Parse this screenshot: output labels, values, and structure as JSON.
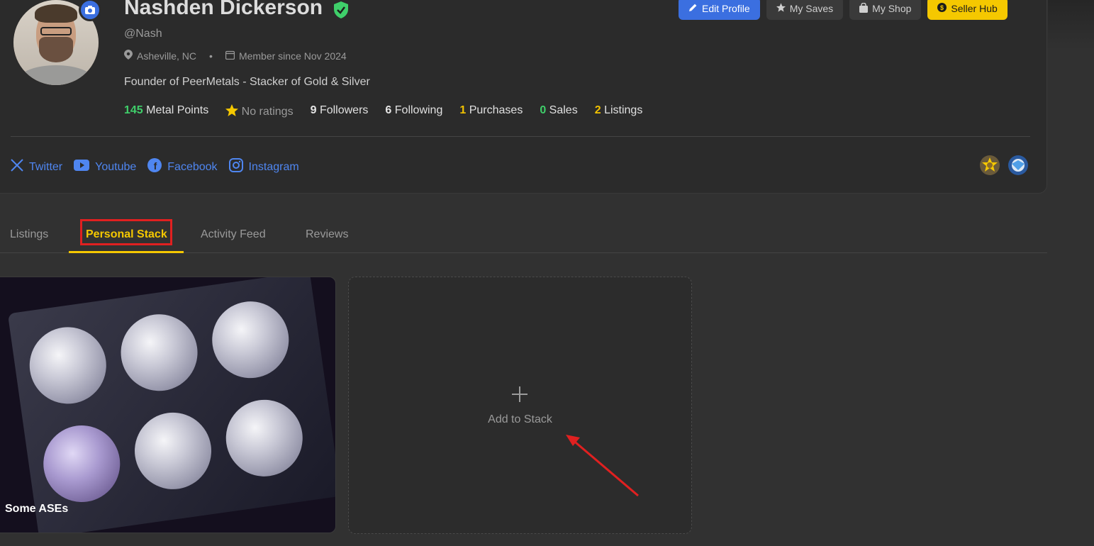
{
  "profile": {
    "name": "Nashden Dickerson",
    "handle": "@Nash",
    "location": "Asheville, NC",
    "member_since": "Member since Nov 2024",
    "bio": "Founder of PeerMetals - Stacker of Gold & Silver"
  },
  "stats": {
    "metal_points_value": "145",
    "metal_points_label": "Metal Points",
    "ratings_label": "No ratings",
    "followers_value": "9",
    "followers_label": "Followers",
    "following_value": "6",
    "following_label": "Following",
    "purchases_value": "1",
    "purchases_label": "Purchases",
    "sales_value": "0",
    "sales_label": "Sales",
    "listings_value": "2",
    "listings_label": "Listings"
  },
  "actions": {
    "edit_profile": "Edit Profile",
    "my_saves": "My Saves",
    "my_shop": "My Shop",
    "seller_hub": "Seller Hub"
  },
  "socials": {
    "twitter": "Twitter",
    "youtube": "Youtube",
    "facebook": "Facebook",
    "instagram": "Instagram"
  },
  "tabs": [
    "Listings",
    "Personal Stack",
    "Activity Feed",
    "Reviews"
  ],
  "stack": {
    "item_label": "Some ASEs",
    "add_label": "Add to Stack"
  },
  "colors": {
    "accent_yellow": "#f5c800",
    "accent_blue": "#3b6fe0",
    "success_green": "#3fcf6a",
    "highlight_red": "#e02020"
  },
  "icons": [
    "camera-icon",
    "verified-shield-icon",
    "map-pin-icon",
    "calendar-icon",
    "pencil-icon",
    "star-icon",
    "bag-icon",
    "dollar-icon",
    "x-twitter-icon",
    "youtube-icon",
    "facebook-icon",
    "instagram-icon",
    "plus-icon"
  ]
}
